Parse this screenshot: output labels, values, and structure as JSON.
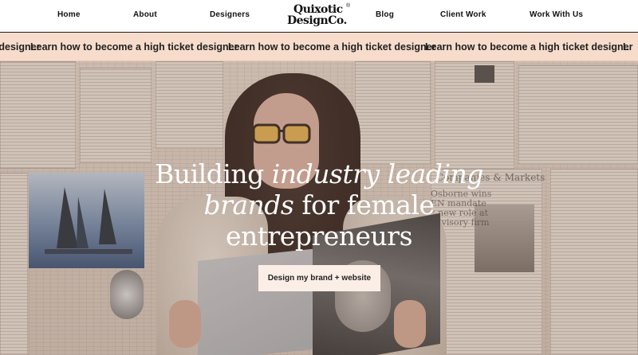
{
  "nav": {
    "items": [
      "Home",
      "About",
      "Designers",
      "Blog",
      "Client Work",
      "Work With Us"
    ],
    "logo": {
      "line1": "Quixotic",
      "line2": "DesignCo.",
      "reg": "®"
    }
  },
  "marquee": {
    "items": [
      "Learn how to become a high ticket designer",
      "Learn how to become a high ticket designer",
      "Learn how to become a high ticket designer",
      "Learn how to become a high ticket designer"
    ]
  },
  "hero": {
    "headline_part1": "Building",
    "headline_italic1": "industry leading",
    "headline_italic2": "brands",
    "headline_part2": "for female",
    "headline_part3": "entrepreneurs",
    "cta_label": "Design my brand + website",
    "newspaper_snippets": [
      "Companies & Markets",
      "Osborne wins",
      "EN mandate",
      "s new role at",
      "advisory firm"
    ]
  },
  "colors": {
    "marquee_bg": "#f7dccb",
    "cta_bg": "#fbeee6",
    "headline": "#ffffff"
  }
}
